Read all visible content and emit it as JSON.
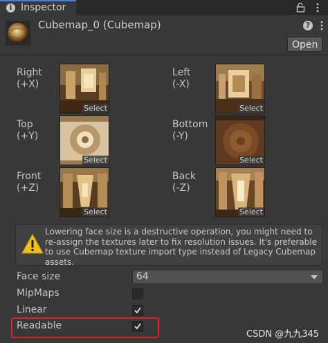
{
  "tab": {
    "title": "Inspector",
    "icon": "info-icon"
  },
  "toolbar": {
    "lock_icon": "lock-icon",
    "menu_icon": "kebab-menu-icon"
  },
  "header": {
    "title": "Cubemap_0 (Cubemap)",
    "help_icon_text": "?",
    "open_label": "Open"
  },
  "faces": [
    {
      "name": "Right",
      "axis": "(+X)",
      "select": "Select"
    },
    {
      "name": "Left",
      "axis": "(-X)",
      "select": "Select"
    },
    {
      "name": "Top",
      "axis": "(+Y)",
      "select": "Select"
    },
    {
      "name": "Bottom",
      "axis": "(-Y)",
      "select": "Select"
    },
    {
      "name": "Front",
      "axis": "(+Z)",
      "select": "Select"
    },
    {
      "name": "Back",
      "axis": "(-Z)",
      "select": "Select"
    }
  ],
  "helpbox": {
    "line1": "Lowering face size is a destructive operation, you might need to",
    "line2": "re-assign the textures later to fix resolution issues. It's preferable",
    "line3": "to use Cubemap texture import type instead of Legacy Cubemap",
    "line4": "assets."
  },
  "properties": {
    "face_size_label": "Face size",
    "face_size_value": "64",
    "mipmaps_label": "MipMaps",
    "mipmaps_checked": false,
    "linear_label": "Linear",
    "linear_checked": true,
    "readable_label": "Readable",
    "readable_checked": true
  },
  "watermark": "CSDN @九九345",
  "colors": {
    "highlight": "#e02020",
    "warning": "#f0c020",
    "tab_accent": "#4d7fd6"
  }
}
